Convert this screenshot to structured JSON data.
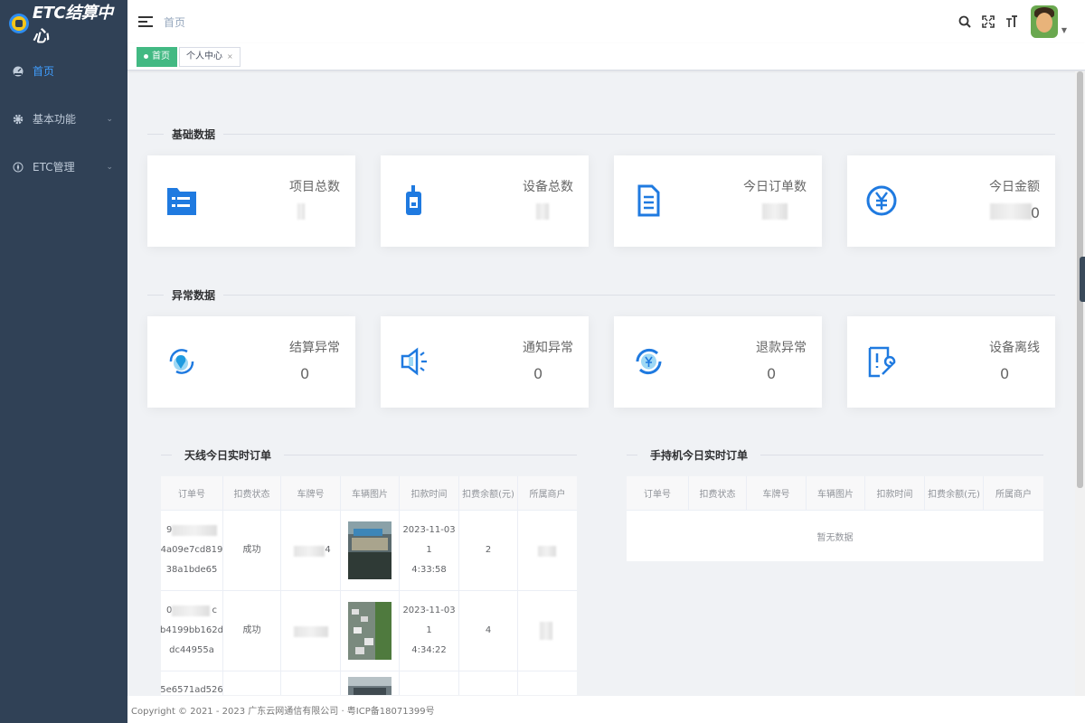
{
  "app": {
    "logo_text": "ETC结算中心"
  },
  "sidebar": {
    "items": [
      {
        "label": "首页",
        "icon": "dashboard-icon",
        "active": true,
        "expandable": false
      },
      {
        "label": "基本功能",
        "icon": "gear-icon",
        "active": false,
        "expandable": true
      },
      {
        "label": "ETC管理",
        "icon": "compass-icon",
        "active": false,
        "expandable": true
      }
    ]
  },
  "header": {
    "breadcrumb": "首页",
    "icons": [
      "search-icon",
      "fullscreen-icon",
      "font-size-icon"
    ]
  },
  "tags": [
    {
      "label": "首页",
      "active": true
    },
    {
      "label": "个人中心",
      "active": false,
      "closable": true
    }
  ],
  "basic_section": {
    "title": "基础数据",
    "cards": [
      {
        "title": "项目总数",
        "value": "",
        "icon": "project-list-icon"
      },
      {
        "title": "设备总数",
        "value": "",
        "icon": "device-icon"
      },
      {
        "title": "今日订单数",
        "value": "",
        "icon": "order-document-icon"
      },
      {
        "title": "今日金额",
        "value": "0",
        "icon": "yuan-icon"
      }
    ]
  },
  "abnormal_section": {
    "title": "异常数据",
    "cards": [
      {
        "title": "结算异常",
        "value": "0",
        "icon": "settlement-error-icon"
      },
      {
        "title": "通知异常",
        "value": "0",
        "icon": "notification-error-icon"
      },
      {
        "title": "退款异常",
        "value": "0",
        "icon": "refund-error-icon"
      },
      {
        "title": "设备离线",
        "value": "0",
        "icon": "device-offline-icon"
      }
    ]
  },
  "antenna_table": {
    "title": "天线今日实时订单",
    "columns": [
      "订单号",
      "扣费状态",
      "车牌号",
      "车辆图片",
      "扣款时间",
      "扣费余额(元)",
      "所属商户"
    ],
    "rows": [
      {
        "order_lines": [
          "9",
          "4a09e7cd819",
          "38a1bde65"
        ],
        "status": "成功",
        "plate": "4",
        "time_lines": [
          "2023-11-03 1",
          "4:33:58"
        ],
        "balance": "2"
      },
      {
        "order_lines": [
          "0",
          "b4199bb162d",
          "dc44955a"
        ],
        "order_tail": "c",
        "status": "成功",
        "plate": "",
        "time_lines": [
          "2023-11-03 1",
          "4:34:22"
        ],
        "balance": "4"
      },
      {
        "order_lines": [
          "5e6571ad526"
        ],
        "status": "",
        "plate": "",
        "time_lines": [],
        "balance": ""
      }
    ]
  },
  "handheld_table": {
    "title": "手持机今日实时订单",
    "columns": [
      "订单号",
      "扣费状态",
      "车牌号",
      "车辆图片",
      "扣款时间",
      "扣费余额(元)",
      "所属商户"
    ],
    "empty_text": "暂无数据"
  },
  "footer": {
    "text": "Copyright © 2021 - 2023 广东云网通信有限公司 · 粤ICP备18071399号"
  },
  "colors": {
    "sidebar": "#304156",
    "accent": "#409eff",
    "tag_active": "#42b983",
    "icon_blue": "#1f7ae0"
  }
}
